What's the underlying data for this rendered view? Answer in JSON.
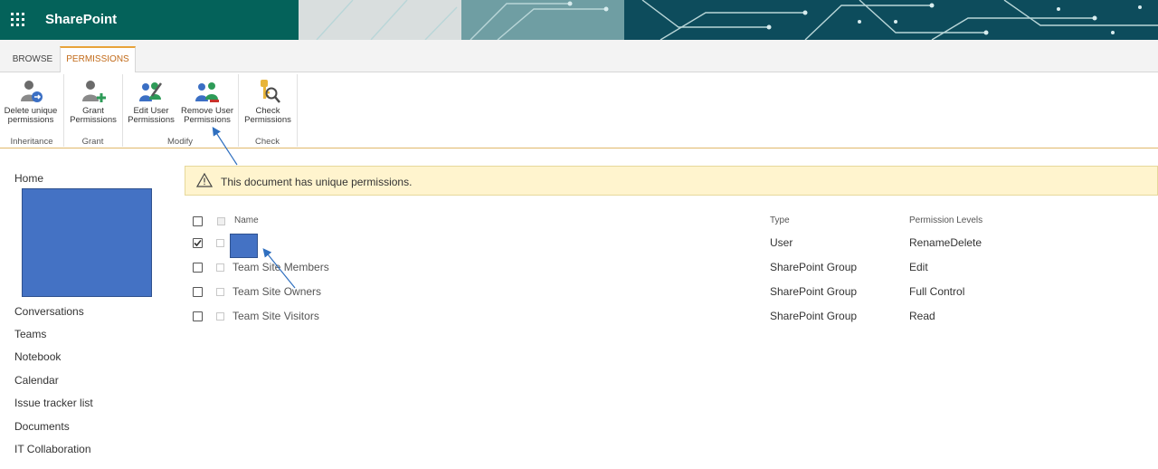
{
  "suite": {
    "brand": "SharePoint"
  },
  "tabs": [
    {
      "label": "BROWSE",
      "selected": false
    },
    {
      "label": "PERMISSIONS",
      "selected": true
    }
  ],
  "ribbon": {
    "buttons": [
      {
        "line1": "Delete unique",
        "line2": "permissions",
        "icon": "delete-permissions-icon"
      },
      {
        "line1": "Grant",
        "line2": "Permissions",
        "icon": "grant-permissions-icon"
      },
      {
        "line1": "Edit User",
        "line2": "Permissions",
        "icon": "edit-user-permissions-icon"
      },
      {
        "line1": "Remove User",
        "line2": "Permissions",
        "icon": "remove-user-permissions-icon"
      },
      {
        "line1": "Check",
        "line2": "Permissions",
        "icon": "check-permissions-icon"
      }
    ],
    "groups": [
      "Inheritance",
      "Grant",
      "Modify",
      "Check"
    ]
  },
  "nav": [
    "Home",
    "Conversations",
    "Teams",
    "Notebook",
    "Calendar",
    "Issue tracker list",
    "Documents",
    "IT Collaboration"
  ],
  "notice": {
    "text": "This document has unique permissions."
  },
  "table": {
    "headers": {
      "name": "Name",
      "type": "Type",
      "levels": "Permission Levels"
    },
    "rows": [
      {
        "name": "",
        "type": "User",
        "levels": "RenameDelete",
        "checked": true
      },
      {
        "name": "Team Site Members",
        "type": "SharePoint Group",
        "levels": "Edit",
        "checked": false
      },
      {
        "name": "Team Site Owners",
        "type": "SharePoint Group",
        "levels": "Full Control",
        "checked": false
      },
      {
        "name": "Team Site Visitors",
        "type": "SharePoint Group",
        "levels": "Read",
        "checked": false
      }
    ]
  },
  "colors": {
    "suite": "#04625a",
    "accent": "#c26b1a",
    "notice": "#fff4ce",
    "redaction": "#4472c4",
    "arrow": "#2f6fbf"
  }
}
